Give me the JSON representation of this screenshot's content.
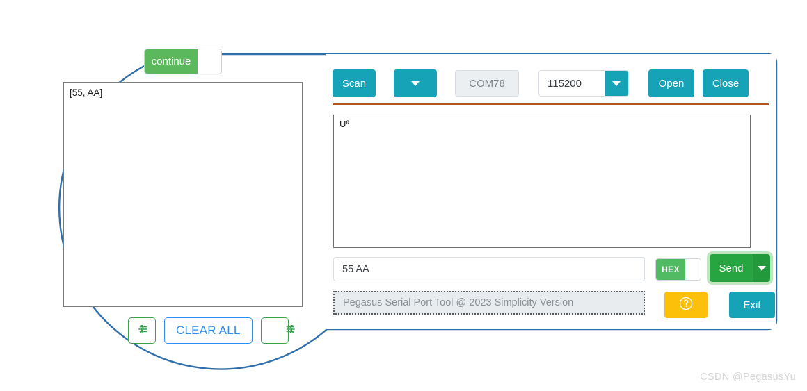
{
  "app": {
    "name": "Pegasus Serial Port Tool",
    "accent_teal": "#16a3b8",
    "accent_green": "#26a541",
    "accent_yellow": "#fcc00a",
    "accent_blue": "#2d8cf0",
    "divider_color": "#b5531d",
    "callout_color": "#2f6fac"
  },
  "toolbar": {
    "scan_label": "Scan",
    "scan_dropdown_icon": "chevron-down-icon",
    "port_value": "COM78",
    "baud_value": "115200",
    "baud_dropdown_icon": "chevron-down-icon",
    "open_label": "Open",
    "close_label": "Close"
  },
  "receive": {
    "text": "Uª"
  },
  "send": {
    "input_value": "55 AA",
    "hex_label": "HEX",
    "send_label": "Send",
    "send_dropdown_icon": "chevron-down-icon"
  },
  "status": {
    "text": "Pegasus Serial Port Tool @ 2023 Simplicity Version"
  },
  "actions": {
    "help_icon": "question-circle-icon",
    "exit_label": "Exit"
  },
  "lens": {
    "toggle_label": "continue",
    "log_text": "[55, AA]",
    "clear_label": "CLEAR ALL",
    "left_icon": "wind-left-icon",
    "right_icon": "wind-right-icon"
  },
  "watermark": {
    "text": "CSDN @PegasusYu"
  }
}
